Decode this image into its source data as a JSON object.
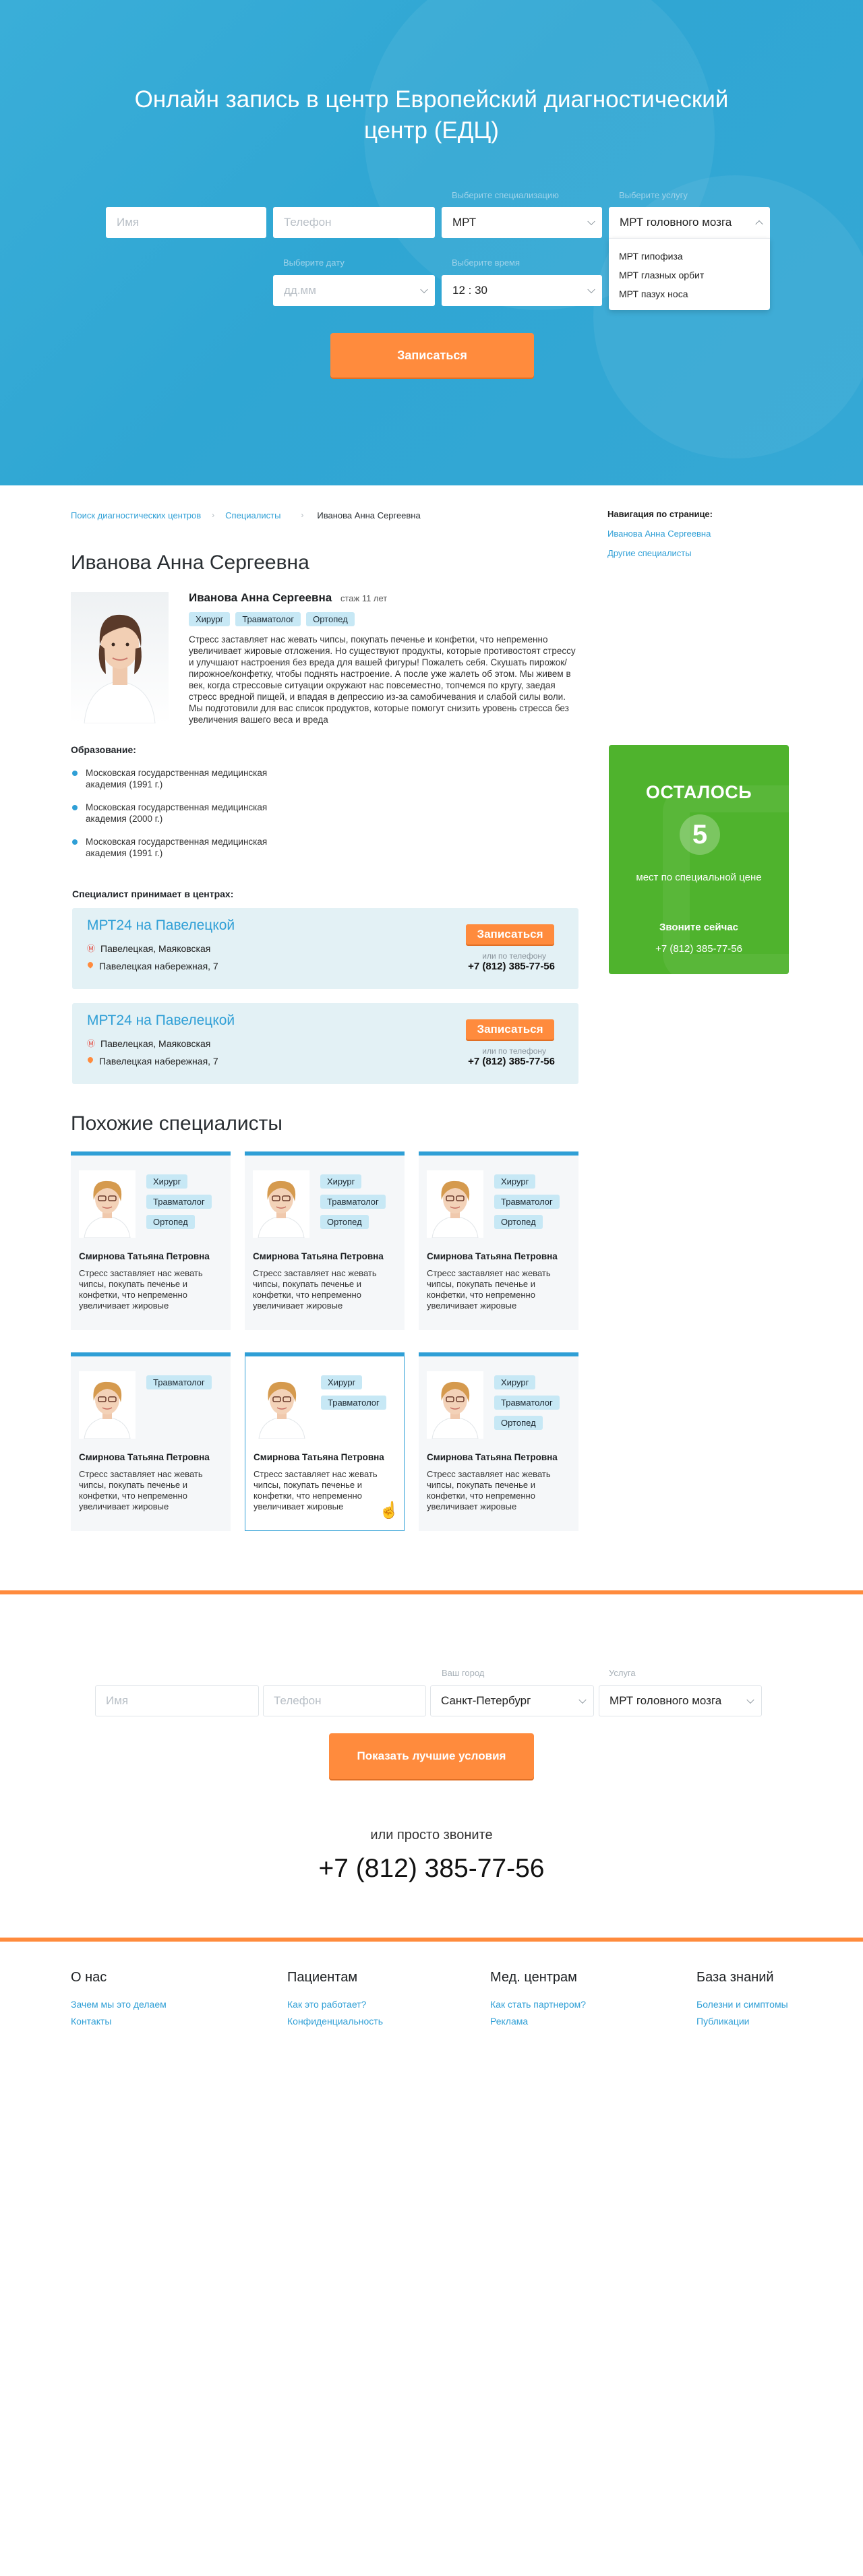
{
  "hero": {
    "title_line1": "Онлайн запись в центр Европейский диагностический",
    "title_line2": "центр (ЕДЦ)",
    "name_placeholder": "Имя",
    "phone_placeholder": "Телефон",
    "specialization_label": "Выберите специализацию",
    "specialization_value": "МРТ",
    "service_label": "Выберите услугу",
    "service_value": "МРТ головного мозга",
    "service_options": [
      "МРТ гипофиза",
      "МРТ глазных орбит",
      "МРТ пазух носа"
    ],
    "date_label": "Выберите дату",
    "date_placeholder": "дд.мм",
    "time_label": "Выберите время",
    "time_value": "12 : 30",
    "submit": "Записаться"
  },
  "breadcrumbs": [
    "Поиск диагностических центров",
    "Специалисты",
    "Иванова Анна Сергеевна"
  ],
  "page_nav": {
    "title": "Навигация по странице:",
    "links": [
      "Иванова Анна Сергеевна",
      "Другие специалисты"
    ]
  },
  "doctor": {
    "title": "Иванова Анна Сергеевна",
    "name": "Иванова Анна Сергеевна",
    "experience": "стаж 11 лет",
    "tags": [
      "Хирург",
      "Травматолог",
      "Ортопед"
    ],
    "bio": "Стресс заставляет нас жевать чипсы, покупать печенье и конфетки, что непременно увеличивает жировые отложения. Но существуют продукты, которые противостоят стрессу и улучшают настроения без вреда для вашей фигуры! Пожалеть себя. Скушать пирожок/пирожное/конфетку, чтобы поднять настроение. А после уже жалеть об этом. Мы живем в век, когда стрессовые ситуации окружают нас повсеместно, топчемся по кругу, заедая стресс вредной пищей, и впадая в депрессию из-за самобичевания и слабой силы воли. Мы подготовили для вас список продуктов, которые помогут снизить уровень стресса без увеличения вашего веса и вреда"
  },
  "education": {
    "title": "Образование:",
    "items": [
      "Московская государственная медицинская академия (1991 г.)",
      "Московская государственная медицинская академия (2000 г.)",
      "Московская государственная медицинская академия (1991 г.)"
    ]
  },
  "centers": {
    "title": "Специалист принимает в центрах:",
    "items": [
      {
        "name": "МРТ24 на Павелецкой",
        "metro": "Павелецкая, Маяковская",
        "address": "Павелецкая набережная, 7",
        "button": "Записаться",
        "or": "или по телефону",
        "phone": "+7 (812) 385-77-56"
      },
      {
        "name": "МРТ24 на Павелецкой",
        "metro": "Павелецкая, Маяковская",
        "address": "Павелецкая набережная, 7",
        "button": "Записаться",
        "or": "или по телефону",
        "phone": "+7 (812) 385-77-56"
      }
    ]
  },
  "promo": {
    "title": "ОСТАЛОСЬ",
    "count": "5",
    "subtitle": "мест по специальной цене",
    "call": "Звоните сейчас",
    "phone": "+7 (812) 385-77-56",
    "color": "#4fb32d"
  },
  "similar": {
    "title": "Похожие специалисты",
    "cards": [
      {
        "tags": [
          "Хирург",
          "Травматолог",
          "Ортопед"
        ],
        "name": "Смирнова Татьяна Петровна",
        "desc": "Стресс заставляет нас жевать чипсы, покупать печенье и конфетки, что непременно увеличивает жировые"
      },
      {
        "tags": [
          "Хирург",
          "Травматолог",
          "Ортопед"
        ],
        "name": "Смирнова Татьяна Петровна",
        "desc": "Стресс заставляет нас жевать чипсы, покупать печенье и конфетки, что непременно увеличивает жировые"
      },
      {
        "tags": [
          "Хирург",
          "Травматолог",
          "Ортопед"
        ],
        "name": "Смирнова Татьяна Петровна",
        "desc": "Стресс заставляет нас жевать чипсы, покупать печенье и конфетки, что непременно увеличивает жировые"
      },
      {
        "tags": [
          "Травматолог"
        ],
        "name": "Смирнова Татьяна Петровна",
        "desc": "Стресс заставляет нас жевать чипсы, покупать печенье и конфетки, что непременно увеличивает жировые"
      },
      {
        "tags": [
          "Хирург",
          "Травматолог"
        ],
        "name": "Смирнова Татьяна Петровна",
        "desc": "Стресс заставляет нас жевать чипсы, покупать печенье и конфетки, что непременно увеличивает жировые"
      },
      {
        "tags": [
          "Хирург",
          "Травматолог",
          "Ортопед"
        ],
        "name": "Смирнова Татьяна Петровна",
        "desc": "Стресс заставляет нас жевать чипсы, покупать печенье и конфетки, что непременно увеличивает жировые"
      }
    ]
  },
  "bottom_form": {
    "name_placeholder": "Имя",
    "phone_placeholder": "Телефон",
    "city_label": "Ваш город",
    "city_value": "Санкт-Петербург",
    "service_label": "Услуга",
    "service_value": "МРТ головного мозга",
    "submit": "Показать лучшие условия",
    "or_call": "или просто звоните",
    "phone": "+7 (812) 385-77-56"
  },
  "footer": {
    "columns": [
      {
        "title": "О нас",
        "links": [
          "Зачем мы это делаем",
          "Контакты"
        ]
      },
      {
        "title": "Пациентам",
        "links": [
          "Как это работает?",
          "Конфиденциальность"
        ]
      },
      {
        "title": "Мед. центрам",
        "links": [
          "Как стать партнером?",
          "Реклама"
        ]
      },
      {
        "title": "База знаний",
        "links": [
          "Болезни и симптомы",
          "Публикации"
        ]
      }
    ]
  },
  "colors": {
    "accent": "#2f9fd6",
    "cta": "#ff8b3d",
    "hero_bg": "#35a8d5"
  }
}
